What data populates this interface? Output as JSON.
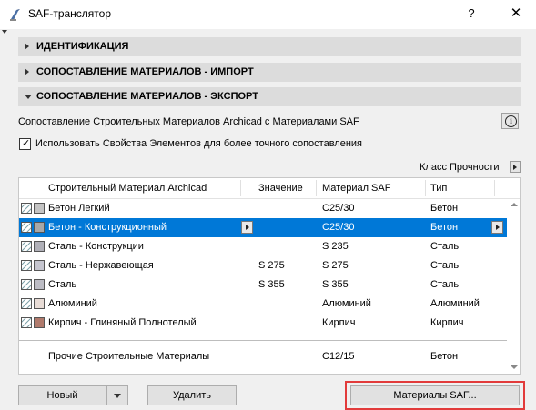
{
  "window": {
    "title": "SAF-транслятор",
    "help": "?",
    "close": "✕"
  },
  "sections": [
    {
      "label": "ИДЕНТИФИКАЦИЯ",
      "expanded": false
    },
    {
      "label": "СОПОСТАВЛЕНИЕ МАТЕРИАЛОВ - ИМПОРТ",
      "expanded": false
    },
    {
      "label": "СОПОСТАВЛЕНИЕ МАТЕРИАЛОВ - ЭКСПОРТ",
      "expanded": true
    }
  ],
  "description": "Сопоставление Строительных Материалов Archicad с Материалами SAF",
  "info_icon": "i",
  "checkbox": {
    "label": "Использовать Свойства Элементов для более точного сопоставления",
    "checked": true,
    "mark": "✓"
  },
  "class_label": "Класс Прочности",
  "table": {
    "headers": {
      "material": "Строительный Материал Archicad",
      "value": "Значение",
      "saf": "Материал SAF",
      "type": "Тип"
    },
    "rows": [
      {
        "name": "Бетон Легкий",
        "value": "",
        "saf": "C25/30",
        "type": "Бетон",
        "color": "#c4c4c4",
        "selected": false
      },
      {
        "name": "Бетон - Конструкционный",
        "value": "",
        "saf": "C25/30",
        "type": "Бетон",
        "color": "#a8a8a8",
        "selected": true
      },
      {
        "name": "Сталь - Конструкции",
        "value": "",
        "saf": "S 235",
        "type": "Сталь",
        "color": "#b0b0b8",
        "selected": false
      },
      {
        "name": "Сталь - Нержавеющая",
        "value": "S 275",
        "saf": "S 275",
        "type": "Сталь",
        "color": "#c6c6d0",
        "selected": false
      },
      {
        "name": "Сталь",
        "value": "S 355",
        "saf": "S 355",
        "type": "Сталь",
        "color": "#bcbcc4",
        "selected": false
      },
      {
        "name": "Алюминий",
        "value": "",
        "saf": "Алюминий",
        "type": "Алюминий",
        "color": "#e8dcd6",
        "selected": false
      },
      {
        "name": "Кирпич - Глиняный Полнотелый",
        "value": "",
        "saf": "Кирпич",
        "type": "Кирпич",
        "color": "#b07a6c",
        "selected": false
      }
    ],
    "other": {
      "name": "Прочие Строительные Материалы",
      "saf": "C12/15",
      "type": "Бетон"
    }
  },
  "buttons": {
    "new": "Новый",
    "delete": "Удалить",
    "saf_materials": "Материалы SAF..."
  }
}
